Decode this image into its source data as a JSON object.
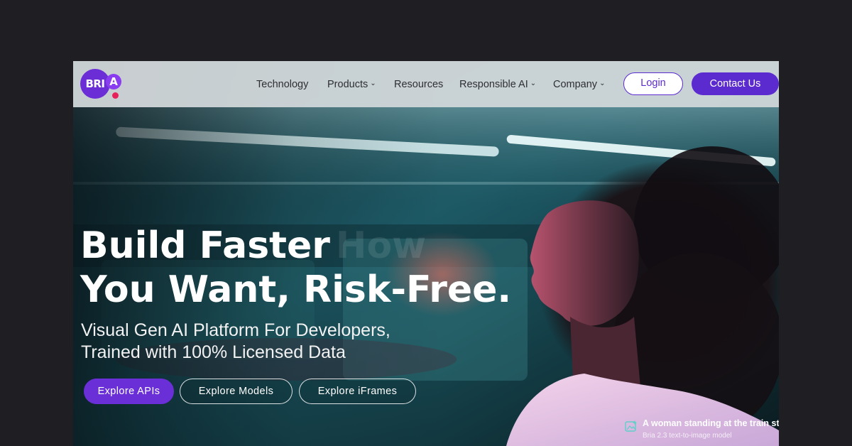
{
  "brand": {
    "logo_text": "BRI",
    "logo_accent": "A",
    "colors": {
      "primary": "#5b2bd0",
      "accent_dot": "#e8205a"
    }
  },
  "nav": {
    "items": [
      {
        "label": "Technology",
        "has_dropdown": false
      },
      {
        "label": "Products",
        "has_dropdown": true
      },
      {
        "label": "Resources",
        "has_dropdown": false
      },
      {
        "label": "Responsible AI",
        "has_dropdown": true
      },
      {
        "label": "Company",
        "has_dropdown": true
      }
    ],
    "login_label": "Login",
    "contact_label": "Contact Us",
    "dropdown_icon": "chevron-down-icon"
  },
  "hero": {
    "headline_line1": "Build Faster",
    "headline_ghost": "How",
    "headline_line2": "You Want, Risk-Free.",
    "subhead_line1": "Visual Gen AI Platform For Developers,",
    "subhead_line2": "Trained with 100% Licensed Data",
    "cta": {
      "primary": "Explore APIs",
      "models": "Explore Models",
      "iframes": "Explore iFrames"
    }
  },
  "caption": {
    "icon": "image-icon",
    "title": "A woman standing at the train st",
    "subtitle": "Bria 2.3 text-to-image model"
  }
}
